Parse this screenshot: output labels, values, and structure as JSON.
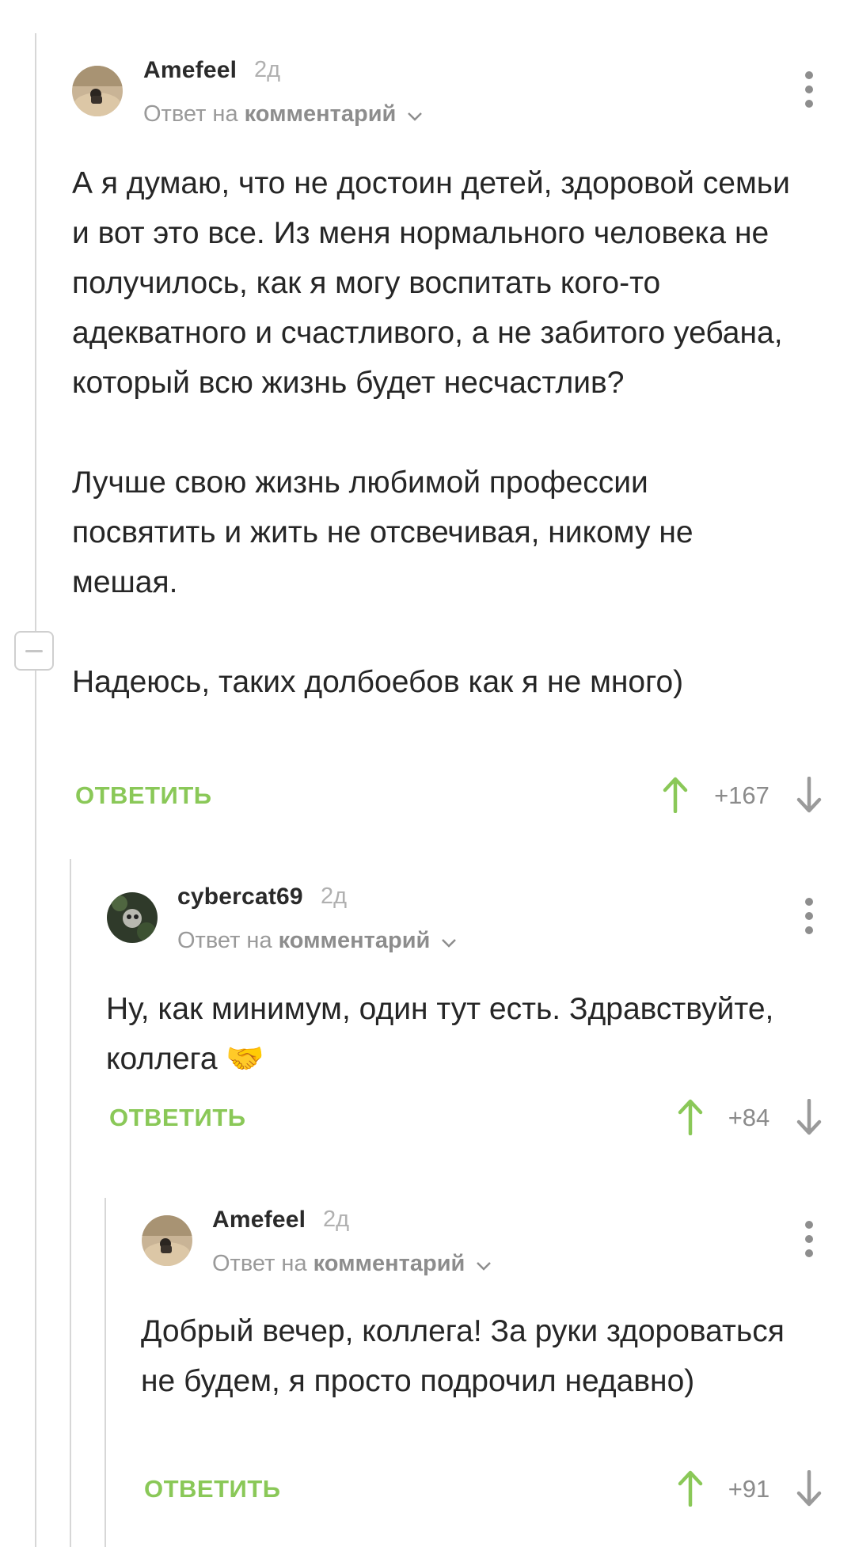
{
  "colors": {
    "accent_green": "#8ac858",
    "thread_line": "#d7d7d7",
    "muted_text": "#9a9a9a"
  },
  "comments": [
    {
      "author": "Amefeel",
      "time": "2д",
      "reply_prefix": "Ответ на",
      "reply_link": "комментарий",
      "paragraphs": [
        "А я думаю, что не достоин детей, здоровой семьи и вот это все. Из меня нормального человека не получилось, как я могу воспитать кого-то адекватного и счастливого, а не забитого уебана, который всю жизнь будет несчастлив?",
        "Лучше свою жизнь любимой профессии посвятить и жить не отсвечивая, никому не мешая.",
        "Надеюсь, таких долбоебов как я не много)"
      ],
      "reply_label": "ОТВЕТИТЬ",
      "rating": "+167"
    },
    {
      "author": "cybercat69",
      "time": "2д",
      "reply_prefix": "Ответ на",
      "reply_link": "комментарий",
      "paragraphs": [
        "Ну, как минимум, один тут есть. Здравствуйте, коллега 🤝"
      ],
      "reply_label": "ОТВЕТИТЬ",
      "rating": "+84"
    },
    {
      "author": "Amefeel",
      "time": "2д",
      "reply_prefix": "Ответ на",
      "reply_link": "комментарий",
      "paragraphs": [
        "Добрый вечер, коллега! За руки здороваться не будем, я просто подрочил недавно)"
      ],
      "reply_label": "ОТВЕТИТЬ",
      "rating": "+91"
    }
  ]
}
